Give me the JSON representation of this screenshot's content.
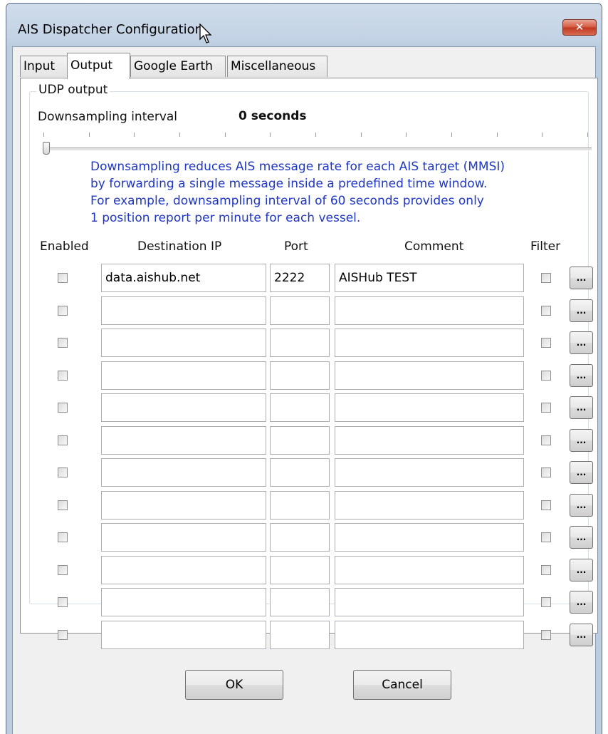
{
  "window": {
    "title": "AIS Dispatcher Configuration",
    "close_label": "✕"
  },
  "tabs": [
    {
      "label": "Input",
      "active": false
    },
    {
      "label": "Output",
      "active": true
    },
    {
      "label": "Google Earth",
      "active": false
    },
    {
      "label": "Miscellaneous",
      "active": false
    }
  ],
  "udp": {
    "group_label": "UDP output",
    "downsampling_label": "Downsampling interval",
    "downsampling_value": "0 seconds",
    "slider_value": 0,
    "info_lines": [
      "Downsampling reduces AIS message rate for each AIS target (MMSI)",
      "by forwarding a single message inside a predefined time window.",
      "For example, downsampling interval of 60 seconds provides only",
      "1 position report per minute for each vessel."
    ]
  },
  "table": {
    "headers": {
      "enabled": "Enabled",
      "destination_ip": "Destination IP",
      "port": "Port",
      "comment": "Comment",
      "filter": "Filter"
    },
    "filter_button_label": "...",
    "rows": [
      {
        "enabled": false,
        "ip": "data.aishub.net",
        "port": "2222",
        "comment": "AISHub TEST",
        "filter": false
      },
      {
        "enabled": false,
        "ip": "",
        "port": "",
        "comment": "",
        "filter": false
      },
      {
        "enabled": false,
        "ip": "",
        "port": "",
        "comment": "",
        "filter": false
      },
      {
        "enabled": false,
        "ip": "",
        "port": "",
        "comment": "",
        "filter": false
      },
      {
        "enabled": false,
        "ip": "",
        "port": "",
        "comment": "",
        "filter": false
      },
      {
        "enabled": false,
        "ip": "",
        "port": "",
        "comment": "",
        "filter": false
      },
      {
        "enabled": false,
        "ip": "",
        "port": "",
        "comment": "",
        "filter": false
      },
      {
        "enabled": false,
        "ip": "",
        "port": "",
        "comment": "",
        "filter": false
      },
      {
        "enabled": false,
        "ip": "",
        "port": "",
        "comment": "",
        "filter": false
      },
      {
        "enabled": false,
        "ip": "",
        "port": "",
        "comment": "",
        "filter": false
      },
      {
        "enabled": false,
        "ip": "",
        "port": "",
        "comment": "",
        "filter": false
      },
      {
        "enabled": false,
        "ip": "",
        "port": "",
        "comment": "",
        "filter": false
      }
    ]
  },
  "buttons": {
    "ok": "OK",
    "cancel": "Cancel"
  },
  "colors": {
    "info_text": "#1f37c2",
    "close_button": "#c9472c"
  }
}
